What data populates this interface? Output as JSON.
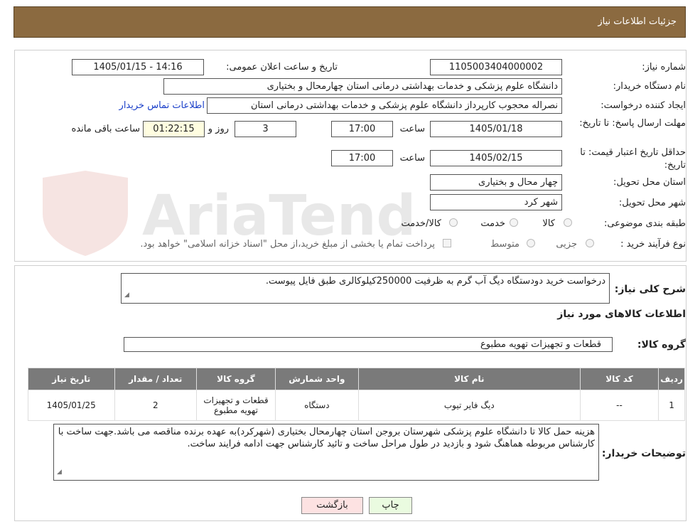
{
  "header": {
    "title": "جزئیات اطلاعات نیاز"
  },
  "fields": {
    "need_number_label": "شماره نیاز:",
    "need_number": "1105003404000002",
    "announce_label": "تاریخ و ساعت اعلان عمومی:",
    "announce_value": "1405/01/15 - 14:16",
    "buyer_org_label": "نام دستگاه خریدار:",
    "buyer_org": "دانشگاه علوم پزشکی و خدمات بهداشتی درمانی استان چهارمحال و بختیاری",
    "requester_label": "ایجاد کننده درخواست:",
    "requester": "نصراله محجوب کارپرداز دانشگاه علوم پزشکی و خدمات بهداشتی درمانی استان",
    "contact_link": "اطلاعات تماس خریدار",
    "reply_deadline_label": "مهلت ارسال پاسخ: تا تاریخ:",
    "reply_date": "1405/01/18",
    "time_label": "ساعت",
    "reply_time": "17:00",
    "days": "3",
    "days_label": "روز و",
    "remaining": "01:22:15",
    "remaining_label": "ساعت باقی مانده",
    "price_validity_label": "حداقل تاریخ اعتبار قیمت: تا تاریخ:",
    "price_date": "1405/02/15",
    "price_time": "17:00",
    "province_label": "استان محل تحویل:",
    "province": "چهار محال و بختیاری",
    "city_label": "شهر محل تحویل:",
    "city": "شهر کرد",
    "category_label": "طبقه بندی موضوعی:",
    "category_options": [
      "کالا",
      "خدمت",
      "کالا/خدمت"
    ],
    "process_label": "نوع فرآیند خرید :",
    "process_options": [
      "جزیی",
      "متوسط"
    ],
    "payment_note": "پرداخت تمام یا بخشی از مبلغ خرید،از محل \"اسناد خزانه اسلامی\" خواهد بود."
  },
  "description": {
    "label": "شرح کلی نیاز:",
    "value": "درخواست خرید دودستگاه دیگ آب گرم  به ظرفیت 250000کیلوکالری طبق فایل پیوست."
  },
  "goods_info_title": "اطلاعات کالاهای مورد نیاز",
  "goods_group": {
    "label": "گروه کالا:",
    "value": "قطعات و تجهیزات تهویه مطبوع"
  },
  "table": {
    "headers": [
      "ردیف",
      "کد کالا",
      "نام کالا",
      "واحد شمارش",
      "گروه کالا",
      "تعداد / مقدار",
      "تاریخ نیاز"
    ],
    "rows": [
      [
        "1",
        "--",
        "دیگ فایر تیوب",
        "دستگاه",
        "قطعات و تجهیزات تهویه مطبوع",
        "2",
        "1405/01/25"
      ]
    ]
  },
  "buyer_notes": {
    "label": "توضیحات خریدار:",
    "value": "هزینه حمل کالا تا دانشگاه علوم پزشکی شهرستان بروجن استان چهارمحال بختیاری (شهرکرد)به عهده برنده مناقصه می باشد.جهت ساخت با کارشناس مربوطه هماهنگ شود و بازدید در طول مراحل ساخت و تائید کارشناس جهت ادامه فرایند ساخت."
  },
  "buttons": {
    "print": "چاپ",
    "back": "بازگشت"
  },
  "watermark": "AriaTender.neT",
  "colors": {
    "header_bg": "#8b6a40",
    "table_header_bg": "#7a7a7a",
    "print_bg": "#eafbe0",
    "back_bg": "#fde2e2",
    "link": "#1a3fc9"
  }
}
